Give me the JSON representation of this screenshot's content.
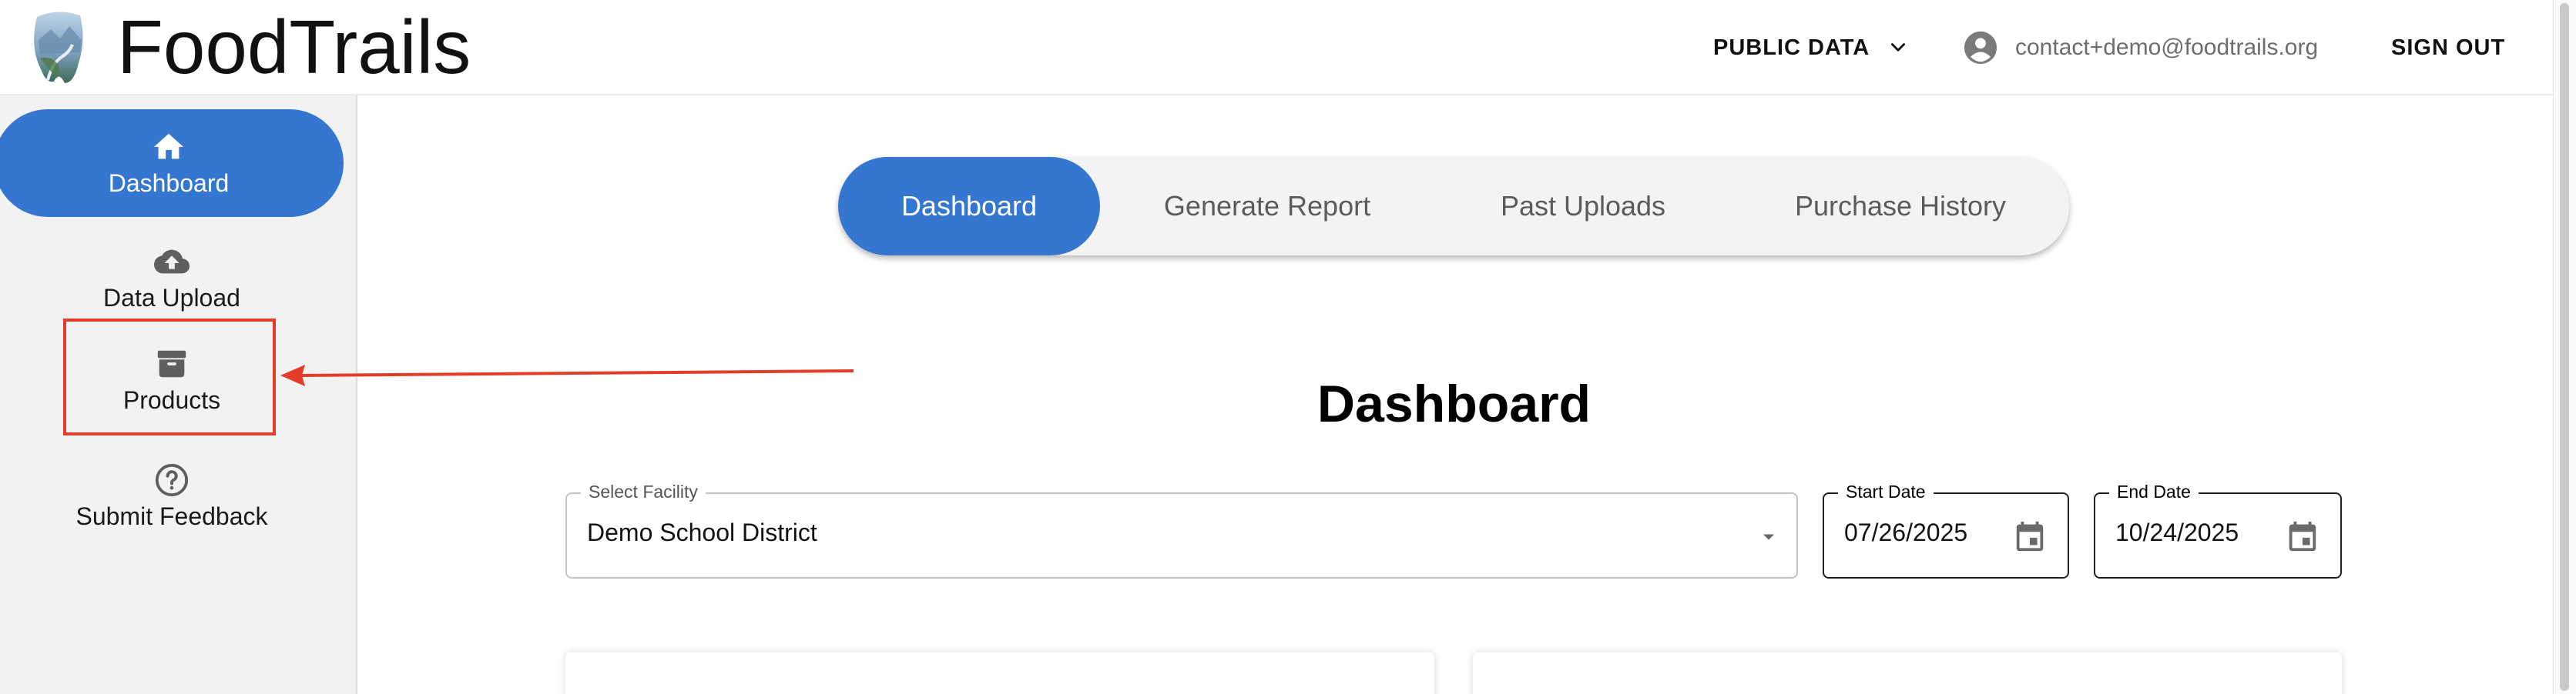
{
  "header": {
    "brand": "FoodTrails",
    "public_data_label": "PUBLIC DATA",
    "user_email": "contact+demo@foodtrails.org",
    "sign_out_label": "SIGN OUT"
  },
  "sidebar": {
    "items": [
      {
        "label": "Dashboard",
        "icon": "home-icon",
        "active": true
      },
      {
        "label": "Data Upload",
        "icon": "cloud-upload-icon",
        "active": false
      },
      {
        "label": "Products",
        "icon": "archive-box-icon",
        "active": false
      },
      {
        "label": "Submit Feedback",
        "icon": "help-circle-icon",
        "active": false
      }
    ]
  },
  "tabs": [
    {
      "label": "Dashboard",
      "active": true
    },
    {
      "label": "Generate Report",
      "active": false
    },
    {
      "label": "Past Uploads",
      "active": false
    },
    {
      "label": "Purchase History",
      "active": false
    }
  ],
  "main": {
    "title": "Dashboard",
    "facility": {
      "label": "Select Facility",
      "value": "Demo School District"
    },
    "start_date": {
      "label": "Start Date",
      "value": "07/26/2025"
    },
    "end_date": {
      "label": "End Date",
      "value": "10/24/2025"
    }
  },
  "annotation": {
    "highlight_color": "#e33d2a",
    "target": "Products"
  },
  "colors": {
    "accent": "#3577d0",
    "sidebar_bg": "#f2f2f2"
  }
}
